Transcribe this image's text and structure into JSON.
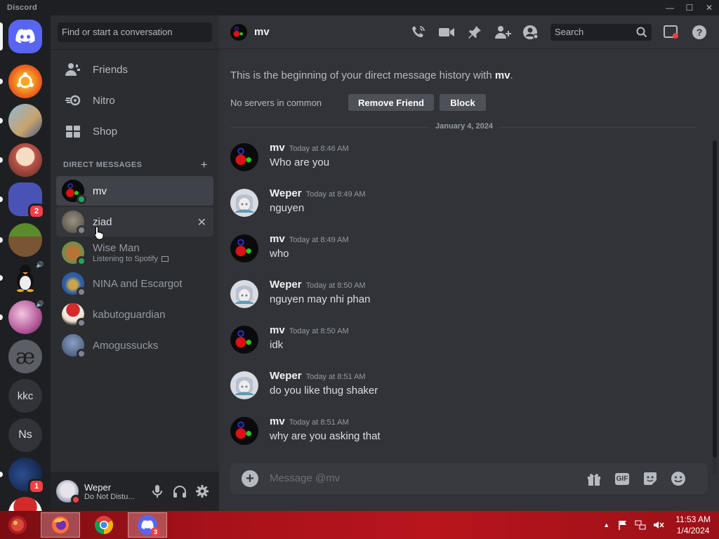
{
  "window": {
    "app_name": "Discord",
    "minimize": "—",
    "maximize": "☐",
    "close": "✕"
  },
  "guilds": [
    {
      "name": "home",
      "badge": ""
    },
    {
      "name": "server-ubuntu",
      "badge": ""
    },
    {
      "name": "server-piano-cat",
      "badge": ""
    },
    {
      "name": "server-anime-hat",
      "badge": ""
    },
    {
      "name": "server-group",
      "badge": "2"
    },
    {
      "name": "server-minecraft",
      "badge": ""
    },
    {
      "name": "server-linux",
      "badge": ""
    },
    {
      "name": "server-anime-girl",
      "badge": ""
    },
    {
      "name": "server-ae",
      "label": "æ"
    },
    {
      "name": "server-kkc",
      "label": "kkc"
    },
    {
      "name": "server-ns",
      "label": "Ns"
    },
    {
      "name": "server-dark",
      "badge": "1"
    }
  ],
  "sidebar": {
    "search_placeholder": "Find or start a conversation",
    "nav": [
      {
        "label": "Friends"
      },
      {
        "label": "Nitro"
      },
      {
        "label": "Shop"
      }
    ],
    "dm_header": "DIRECT MESSAGES",
    "dm_add": "+",
    "dms": [
      {
        "name": "mv",
        "status": "online",
        "sub": ""
      },
      {
        "name": "ziad",
        "status": "offline",
        "sub": ""
      },
      {
        "name": "Wise Man",
        "status": "online",
        "sub": "Listening to Spotify"
      },
      {
        "name": "NINA and Escargot",
        "status": "offline",
        "sub": ""
      },
      {
        "name": "kabutoguardian",
        "status": "offline",
        "sub": ""
      },
      {
        "name": "Amogussucks",
        "status": "offline",
        "sub": ""
      }
    ],
    "dm_close": "✕",
    "user": {
      "name": "Weper",
      "status": "Do Not Distu..."
    }
  },
  "chat": {
    "title": "mv",
    "search_placeholder": "Search",
    "intro_prefix": "This is the beginning of your direct message history with ",
    "intro_name": "mv",
    "intro_suffix": ".",
    "no_servers": "No servers in common",
    "remove_friend": "Remove Friend",
    "block": "Block",
    "date_divider": "January 4, 2024",
    "messages": [
      {
        "author": "mv",
        "time": "Today at 8:46 AM",
        "text": "Who are you"
      },
      {
        "author": "Weper",
        "time": "Today at 8:49 AM",
        "text": "nguyen"
      },
      {
        "author": "mv",
        "time": "Today at 8:49 AM",
        "text": "who"
      },
      {
        "author": "Weper",
        "time": "Today at 8:50 AM",
        "text": "nguyen may nhi phan"
      },
      {
        "author": "mv",
        "time": "Today at 8:50 AM",
        "text": "idk"
      },
      {
        "author": "Weper",
        "time": "Today at 8:51 AM",
        "text": "do you like thug shaker"
      },
      {
        "author": "mv",
        "time": "Today at 8:51 AM",
        "text": "why are you asking that"
      }
    ],
    "composer_placeholder": "Message @mv",
    "composer_plus": "+",
    "gif_label": "GIF"
  },
  "taskbar": {
    "time": "11:53 AM",
    "date": "1/4/2024",
    "discord_badge": "3"
  },
  "colors": {
    "online": "#23a55a",
    "offline": "#80848e",
    "dnd": "#f23f43",
    "blurple": "#5865f2"
  }
}
